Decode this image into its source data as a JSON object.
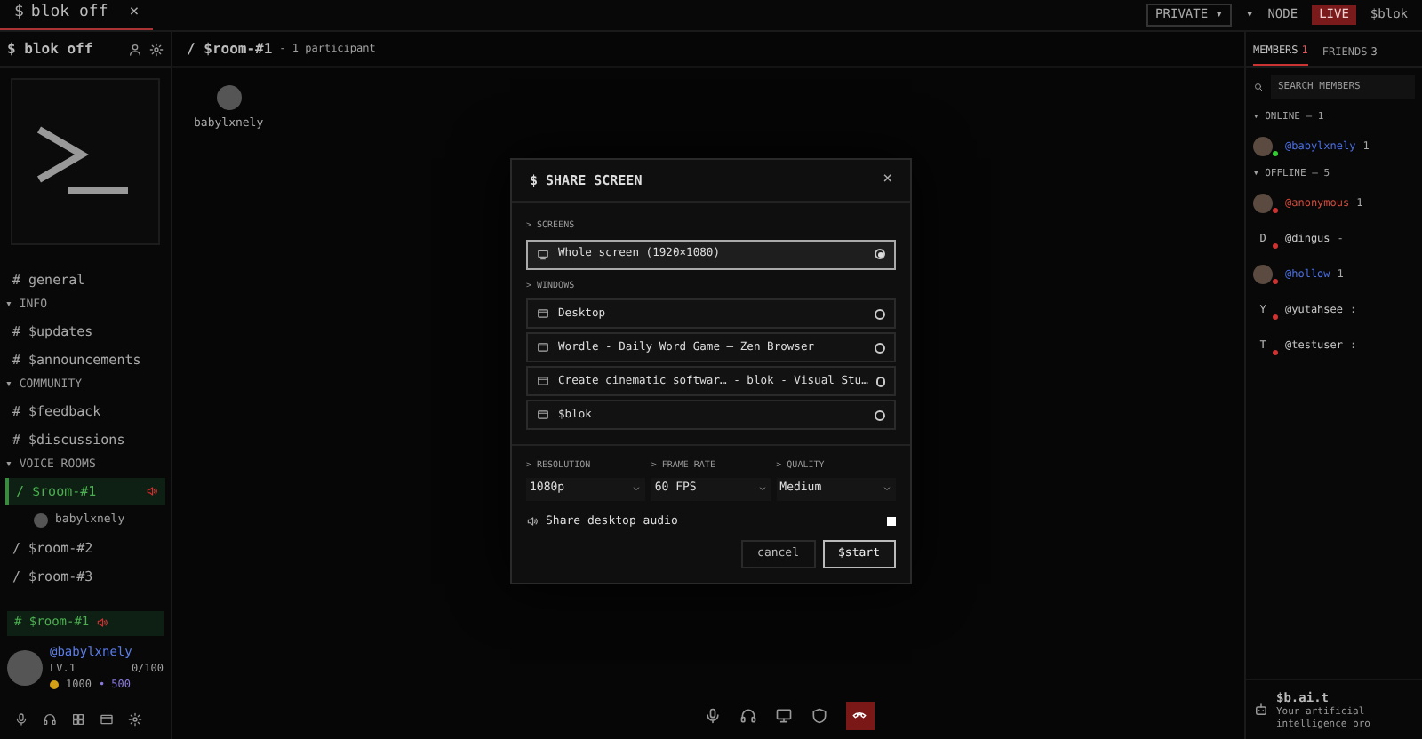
{
  "top_bar": {
    "tab": {
      "icon": "$",
      "label": "blok off",
      "close": "×"
    },
    "right": [
      {
        "label": "PRIVATE ▾",
        "kind": "pill"
      },
      {
        "label": "▾",
        "kind": "plain"
      },
      {
        "label": "NODE",
        "kind": "plain"
      },
      {
        "label": "LIVE",
        "kind": "alert"
      },
      {
        "label": "$blok",
        "kind": "plain"
      }
    ]
  },
  "sidebar": {
    "title_prefix": "$",
    "title": "blok off",
    "channels": [
      {
        "kind": "channel",
        "prefix": "#",
        "label": "general",
        "selected": false
      },
      {
        "kind": "section",
        "caret": "▾",
        "label": "INFO"
      },
      {
        "kind": "channel",
        "prefix": "#",
        "label": "$updates",
        "selected": false
      },
      {
        "kind": "channel",
        "prefix": "#",
        "label": "$announcements",
        "selected": false
      },
      {
        "kind": "section",
        "caret": "▾",
        "label": "COMMUNITY"
      },
      {
        "kind": "channel",
        "prefix": "#",
        "label": "$feedback",
        "selected": false
      },
      {
        "kind": "channel",
        "prefix": "#",
        "label": "$discussions",
        "selected": false
      },
      {
        "kind": "section",
        "caret": "▾",
        "label": "VOICE ROOMS"
      },
      {
        "kind": "voice",
        "prefix": "/",
        "label": "$room-#1",
        "selected": true,
        "children": [
          {
            "label": "babylxnely"
          }
        ]
      },
      {
        "kind": "voice",
        "prefix": "/",
        "label": "$room-#2",
        "selected": false
      },
      {
        "kind": "voice",
        "prefix": "/",
        "label": "$room-#3",
        "selected": false
      }
    ],
    "voice_status": {
      "prefix": "#",
      "label": "$room-#1"
    },
    "user": {
      "name": "@babylxnely",
      "level": "LV.1",
      "xp": "0/100",
      "coins": "1000",
      "separator": "•",
      "points": "500"
    }
  },
  "main": {
    "prefix": "/",
    "room": "$room-#1",
    "participants": "- 1 participant",
    "tiles": [
      {
        "name": "babylxnely"
      }
    ]
  },
  "members_panel": {
    "tabs": [
      {
        "label": "MEMBERS",
        "count": "1",
        "selected": true
      },
      {
        "label": "FRIENDS",
        "count": "3",
        "selected": false
      }
    ],
    "search": {
      "placeholder": "SEARCH MEMBERS"
    },
    "groups": [
      {
        "caret": "▾",
        "label": "ONLINE — 1",
        "kind": "online",
        "members": [
          {
            "name": "@babylxnely",
            "color": "#4c6fe0",
            "note": "1"
          }
        ]
      },
      {
        "caret": "▾",
        "label": "OFFLINE — 5",
        "kind": "offline",
        "members": [
          {
            "name": "@anonymous",
            "color": "#d04a3a",
            "note": "1"
          },
          {
            "name": "@dingus",
            "color": "#c8c8c8",
            "initial": "D",
            "note": "-"
          },
          {
            "name": "@hollow",
            "color": "#4c6fe0",
            "note": "1"
          },
          {
            "name": "@yutahsee",
            "color": "#c8c8c8",
            "initial": "Y",
            "note": ":"
          },
          {
            "name": "@testuser",
            "color": "#c8c8c8",
            "initial": "T",
            "note": ":"
          }
        ]
      }
    ],
    "assistant": {
      "name": "$b.ai.t",
      "description": "Your artificial intelligence bro"
    }
  },
  "dialog": {
    "title_prefix": "$",
    "title": "SHARE SCREEN",
    "close": "×",
    "sections": [
      {
        "label": "> SCREENS",
        "options": [
          {
            "kind": "screen",
            "label": "Whole screen (1920×1080)",
            "selected": true
          }
        ]
      },
      {
        "label": "> WINDOWS",
        "options": [
          {
            "kind": "window",
            "label": "Desktop",
            "selected": false
          },
          {
            "kind": "window",
            "label": "Wordle - Daily Word Game — Zen Browser",
            "selected": false
          },
          {
            "kind": "window",
            "label": "Create cinematic softwar… - blok - Visual Stu…",
            "selected": false
          },
          {
            "kind": "window",
            "label": "$blok",
            "selected": false
          }
        ]
      }
    ],
    "settings": [
      {
        "label": "> RESOLUTION",
        "value": "1080p"
      },
      {
        "label": "> FRAME RATE",
        "value": "60 FPS"
      },
      {
        "label": "> QUALITY",
        "value": "Medium"
      }
    ],
    "audio": {
      "label": "Share desktop audio",
      "checked": true
    },
    "buttons": [
      {
        "kind": "secondary",
        "label": "cancel"
      },
      {
        "kind": "primary",
        "label": "$start"
      }
    ]
  }
}
